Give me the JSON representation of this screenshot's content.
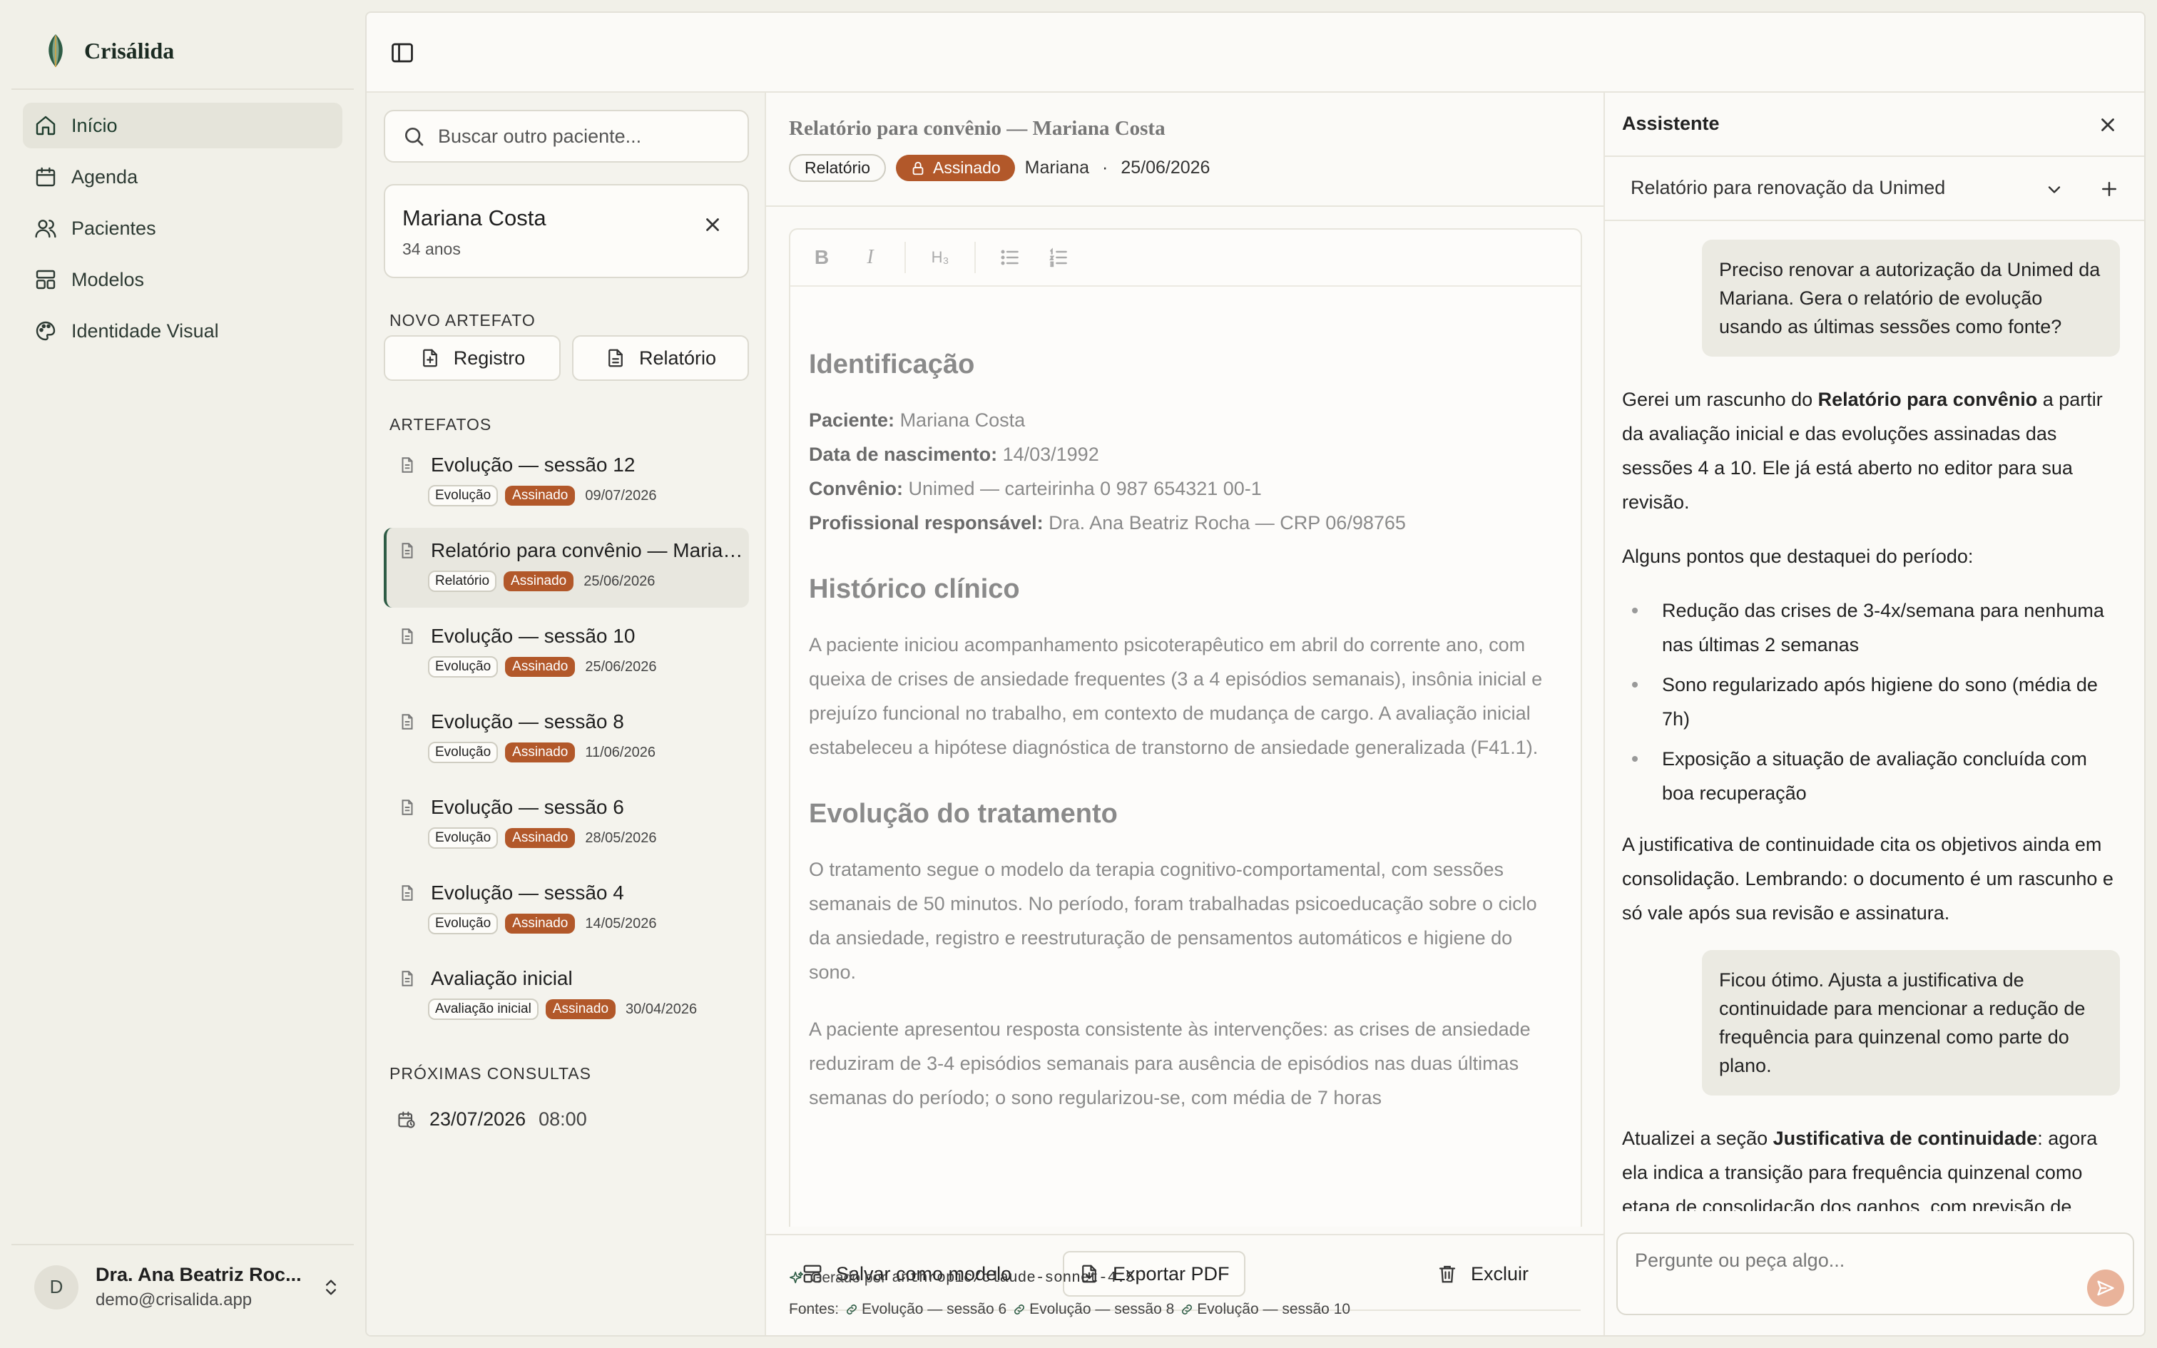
{
  "app": {
    "name": "Crisálida"
  },
  "nav": {
    "items": [
      {
        "label": "Início"
      },
      {
        "label": "Agenda"
      },
      {
        "label": "Pacientes"
      },
      {
        "label": "Modelos"
      },
      {
        "label": "Identidade Visual"
      }
    ]
  },
  "user": {
    "initial": "D",
    "name": "Dra. Ana Beatriz Roc...",
    "email": "demo@crisalida.app"
  },
  "patient_panel": {
    "search_placeholder": "Buscar outro paciente...",
    "patient": {
      "name": "Mariana Costa",
      "age": "34 anos"
    },
    "new_artifact_label": "NOVO ARTEFATO",
    "new_buttons": {
      "registro": "Registro",
      "relatorio": "Relatório"
    },
    "artifacts_label": "ARTEFATOS",
    "artifacts": [
      {
        "title": "Evolução — sessão 12",
        "type": "Evolução",
        "status": "Assinado",
        "date": "09/07/2026"
      },
      {
        "title": "Relatório para convênio — Mariana Costa",
        "type": "Relatório",
        "status": "Assinado",
        "date": "25/06/2026"
      },
      {
        "title": "Evolução — sessão 10",
        "type": "Evolução",
        "status": "Assinado",
        "date": "25/06/2026"
      },
      {
        "title": "Evolução — sessão 8",
        "type": "Evolução",
        "status": "Assinado",
        "date": "11/06/2026"
      },
      {
        "title": "Evolução — sessão 6",
        "type": "Evolução",
        "status": "Assinado",
        "date": "28/05/2026"
      },
      {
        "title": "Evolução — sessão 4",
        "type": "Evolução",
        "status": "Assinado",
        "date": "14/05/2026"
      },
      {
        "title": "Avaliação inicial",
        "type": "Avaliação inicial",
        "status": "Assinado",
        "date": "30/04/2026"
      }
    ],
    "next_label": "PRÓXIMAS CONSULTAS",
    "next_appointment": {
      "date": "23/07/2026",
      "time": "08:00"
    }
  },
  "document": {
    "title": "Relatório para convênio — Mariana Costa",
    "type_tag": "Relatório",
    "status": "Assinado",
    "author": "Mariana",
    "dot": "·",
    "date": "25/06/2026",
    "toolbar": {
      "bold": "B",
      "italic": "I",
      "heading": "H₃"
    },
    "sections": {
      "identificacao": {
        "heading": "Identificação",
        "fields": [
          {
            "label": "Paciente:",
            "value": " Mariana Costa"
          },
          {
            "label": "Data de nascimento:",
            "value": " 14/03/1992"
          },
          {
            "label": "Convênio:",
            "value": " Unimed — carteirinha 0 987 654321 00-1"
          },
          {
            "label": "Profissional responsável:",
            "value": " Dra. Ana Beatriz Rocha — CRP 06/98765"
          }
        ]
      },
      "historico": {
        "heading": "Histórico clínico",
        "text": "A paciente iniciou acompanhamento psicoterapêutico em abril do corrente ano, com queixa de crises de ansiedade frequentes (3 a 4 episódios semanais), insônia inicial e prejuízo funcional no trabalho, em contexto de mudança de cargo. A avaliação inicial estabeleceu a hipótese diagnóstica de transtorno de ansiedade generalizada (F41.1)."
      },
      "evolucao": {
        "heading": "Evolução do tratamento",
        "p1": "O tratamento segue o modelo da terapia cognitivo-comportamental, com sessões semanais de 50 minutos. No período, foram trabalhadas psicoeducação sobre o ciclo da ansiedade, registro e reestruturação de pensamentos automáticos e higiene do sono.",
        "p2": "A paciente apresentou resposta consistente às intervenções: as crises de ansiedade reduziram de 3-4 episódios semanais para ausência de episódios nas duas últimas semanas do período; o sono regularizou-se, com média de 7 horas"
      }
    },
    "footer": {
      "save_template": "Salvar como modelo",
      "export_pdf": "Exportar PDF",
      "delete": "Excluir",
      "generated_by": "Gerado por",
      "model": "anthropic/claude-sonnet-4.5",
      "sources_label": "Fontes:",
      "sources": [
        "Evolução — sessão 6",
        "Evolução — sessão 8",
        "Evolução — sessão 10"
      ]
    }
  },
  "assistant": {
    "title": "Assistente",
    "conversation": "Relatório para renovação da Unimed",
    "messages": {
      "u1": "Preciso renovar a autorização da Unimed da Mariana. Gera o relatório de evolução usando as últimas sessões como fonte?",
      "a1_pre": "Gerei um rascunho do ",
      "a1_bold": "Relatório para convênio",
      "a1_post": " a partir da avaliação inicial e das evoluções assinadas das sessões 4 a 10. Ele já está aberto no editor para sua revisão.",
      "a2": "Alguns pontos que destaquei do período:",
      "bullets": [
        "Redução das crises de 3-4x/semana para nenhuma nas últimas 2 semanas",
        "Sono regularizado após higiene do sono (média de 7h)",
        "Exposição a situação de avaliação concluída com boa recuperação"
      ],
      "a3": "A justificativa de continuidade cita os objetivos ainda em consolidação. Lembrando: o documento é um rascunho e só vale após sua revisão e assinatura.",
      "u2": "Ficou ótimo. Ajusta a justificativa de continuidade para mencionar a redução de frequência para quinzenal como parte do plano.",
      "a4_pre": "Atualizei a seção ",
      "a4_bold": "Justificativa de continuidade",
      "a4_post": ": agora ela indica a transição para frequência quinzenal como etapa de consolidação dos ganhos, com previsão de"
    },
    "input_placeholder": "Pergunte ou peça algo..."
  },
  "colors": {
    "accent_green": "#2E5C45",
    "signed_badge": "#B2582A",
    "send_button": "#E9B39A"
  }
}
